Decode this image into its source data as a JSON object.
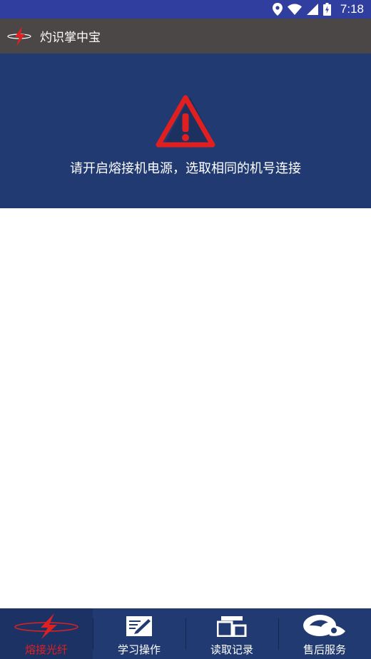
{
  "colors": {
    "status_bar": "#303F9F",
    "app_bar": "#4A4746",
    "banner": "#213A72",
    "bottom_nav": "#213A72",
    "warning_red": "#E02020",
    "active_label": "#E02020"
  },
  "status_bar": {
    "icons": [
      "location-icon",
      "wifi-icon",
      "signal-icon",
      "battery-icon"
    ],
    "time": "7:18"
  },
  "app_bar": {
    "logo_icon": "lightning-logo-icon",
    "title": "灼识掌中宝"
  },
  "banner": {
    "icon": "warning-icon",
    "message": "请开启熔接机电源，选取相同的机号连接"
  },
  "bottom_nav": {
    "items": [
      {
        "label": "熔接光纤",
        "icon": "lightning-fiber-icon",
        "active": true
      },
      {
        "label": "学习操作",
        "icon": "notepad-pen-icon",
        "active": false
      },
      {
        "label": "读取记录",
        "icon": "devices-icon",
        "active": false
      },
      {
        "label": "售后服务",
        "icon": "service-icon",
        "active": false
      }
    ]
  }
}
